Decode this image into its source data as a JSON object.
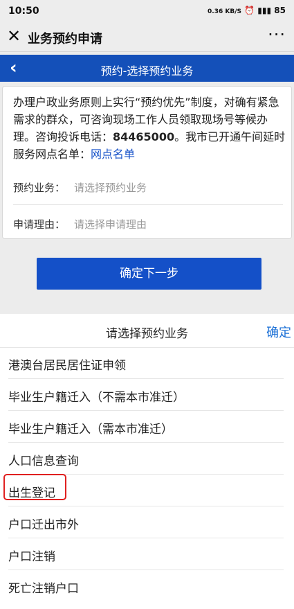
{
  "status": {
    "time": "10:50",
    "battery": "85",
    "net": "0.36 KB/S"
  },
  "app": {
    "title": "业务预约申请",
    "close_icon": "close-icon",
    "more_icon": "more-icon"
  },
  "nav": {
    "title": "预约-选择预约业务",
    "back_icon": "back-chevron-icon"
  },
  "notice": {
    "text_before": "办理户政业务原则上实行“预约优先”制度，对确有紧急需求的群众，可咨询现场工作人员领取现场号等候办理。咨询投诉电话：",
    "phone": "84465000",
    "text_after": "。我市已开通午间延时服务网点名单：",
    "link": "网点名单"
  },
  "form": {
    "business_label": "预约业务：",
    "business_placeholder": "请选择预约业务",
    "reason_label": "申请理由：",
    "reason_placeholder": "请选择申请理由"
  },
  "next_button": "确定下一步",
  "picker": {
    "title": "请选择预约业务",
    "confirm": "确定",
    "options": [
      "港澳台居民居住证申领",
      "毕业生户籍迁入（不需本市准迁）",
      "毕业生户籍迁入（需本市准迁）",
      "人口信息查询",
      "出生登记",
      "户口迁出市外",
      "户口注销",
      "死亡注销户口"
    ],
    "highlighted_option": "出生登记"
  },
  "colors": {
    "nav_bg": "#1450b9",
    "button_bg": "#1450c8",
    "link": "#1450c8",
    "highlight_border": "#e02020"
  }
}
